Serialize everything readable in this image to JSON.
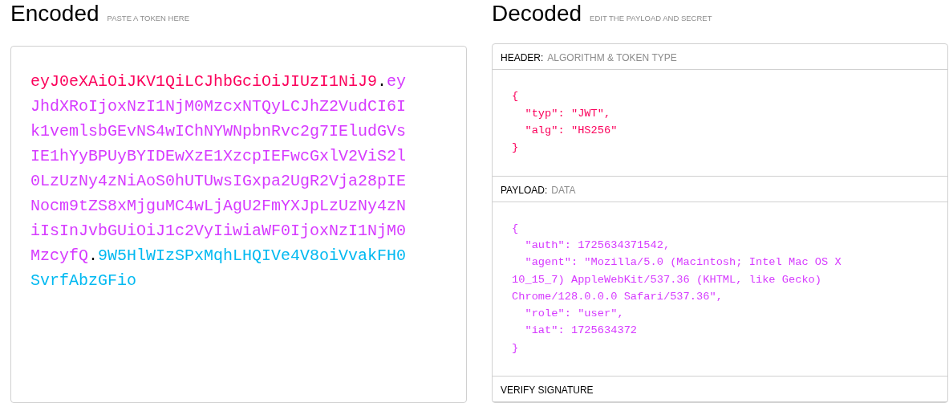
{
  "encoded": {
    "title": "Encoded",
    "hint": "PASTE A TOKEN HERE",
    "parts": [
      {
        "kind": "segment",
        "text": "eyJ0eXAiOiJKV1QiLCJhbGciOiJIUzI1NiJ9",
        "color": "#fb015b"
      },
      {
        "kind": "dot",
        "text": "."
      },
      {
        "kind": "segment",
        "text": "eyJhdXRoIjoxNzI1NjM0MzcxNTQyLCJhZ2VudCI6Ik1vemlsbGEvNS4wIChNYWNpbnRvc2g7IEludGVsIE1hYyBPUyBYIDEwXzE1XzcpIEFwcGxlV2ViS2l0LzUzNy4zNiAoS0hUTUwsIGxpa2UgR2Vja28pIENocm9tZS8xMjguMC4wLjAgU2FmYXJpLzUzNy4zNiIsInJvbGUiOiJ1c2VyIiwiaWF0IjoxNzI1NjM0MzcyfQ",
        "color": "#d63aff"
      },
      {
        "kind": "dot",
        "text": "."
      },
      {
        "kind": "segment",
        "text": "9W5HlWIzSPxMqhLHQIVe4V8oiVvakFH0SvrfAbzGFio",
        "color": "#00b9f1"
      }
    ]
  },
  "decoded": {
    "title": "Decoded",
    "hint": "EDIT THE PAYLOAD AND SECRET",
    "sections": [
      {
        "kind": "code",
        "label": "HEADER:",
        "sublabel": "ALGORITHM & TOKEN TYPE",
        "color": "#fb015b",
        "code": "{\n  \"typ\": \"JWT\",\n  \"alg\": \"HS256\"\n}"
      },
      {
        "kind": "code",
        "label": "PAYLOAD:",
        "sublabel": "DATA",
        "color": "#d63aff",
        "code": "{\n  \"auth\": 1725634371542,\n  \"agent\": \"Mozilla/5.0 (Macintosh; Intel Mac OS X 10_15_7) AppleWebKit/537.36 (KHTML, like Gecko) Chrome/128.0.0.0 Safari/537.36\",\n  \"role\": \"user\",\n  \"iat\": 1725634372\n}"
      },
      {
        "kind": "label",
        "label": "VERIFY SIGNATURE"
      }
    ]
  }
}
